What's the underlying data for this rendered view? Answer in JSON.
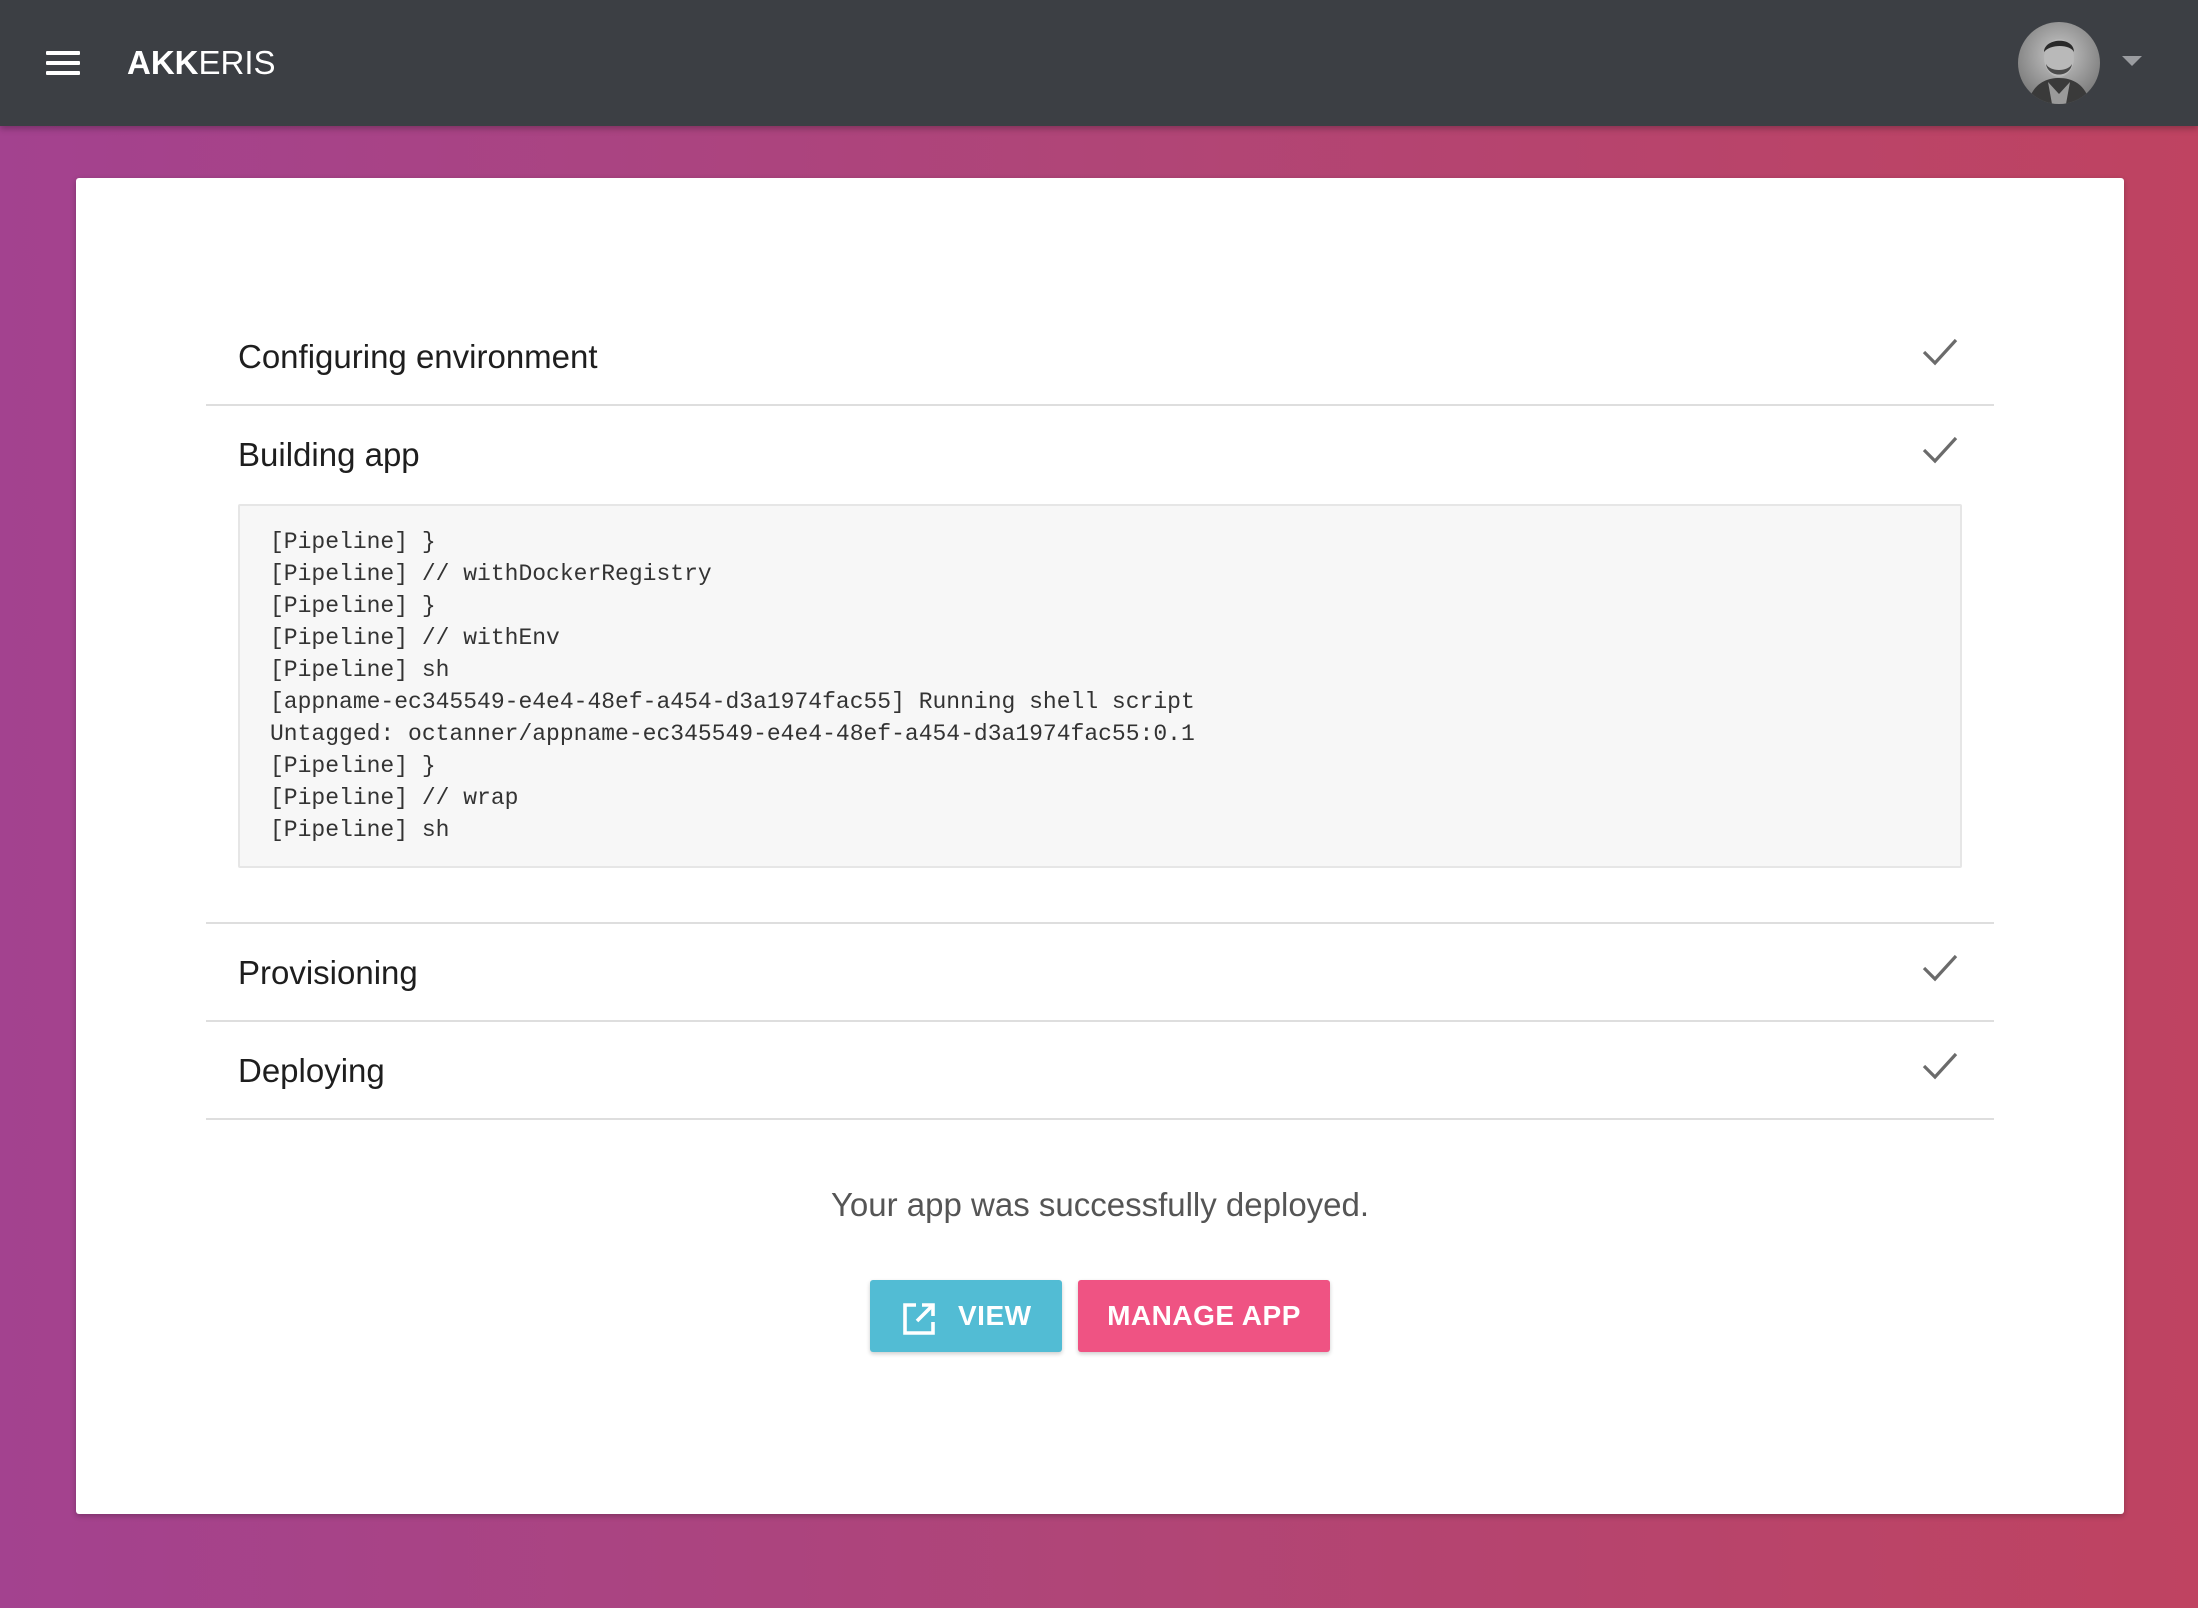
{
  "header": {
    "logo_bold": "AKK",
    "logo_light": "ERIS"
  },
  "steps": [
    {
      "label": "Configuring environment",
      "status": "complete"
    },
    {
      "label": "Building app",
      "status": "complete"
    },
    {
      "label": "Provisioning",
      "status": "complete"
    },
    {
      "label": "Deploying",
      "status": "complete"
    }
  ],
  "build_log": [
    "[Pipeline] }",
    "[Pipeline] // withDockerRegistry",
    "[Pipeline] }",
    "[Pipeline] // withEnv",
    "[Pipeline] sh",
    "[appname-ec345549-e4e4-48ef-a454-d3a1974fac55] Running shell script",
    "Untagged: octanner/appname-ec345549-e4e4-48ef-a454-d3a1974fac55:0.1",
    "[Pipeline] }",
    "[Pipeline] // wrap",
    "[Pipeline] sh"
  ],
  "message": "Your app was successfully deployed.",
  "actions": {
    "view_label": "VIEW",
    "manage_label": "MANAGE APP"
  },
  "colors": {
    "topbar": "#3c3f44",
    "view_button": "#52bcd4",
    "manage_button": "#ef5383",
    "check": "#6b6b6b"
  }
}
